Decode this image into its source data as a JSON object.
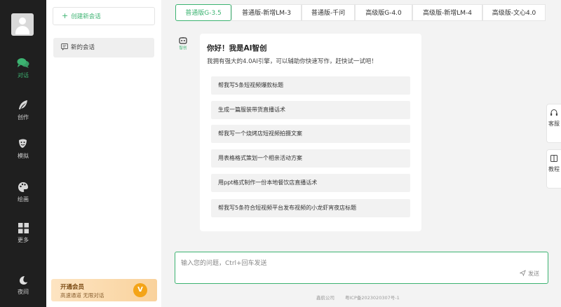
{
  "nav": {
    "items": [
      {
        "label": "对话",
        "icon": "chat-bubbles-icon",
        "active": true
      },
      {
        "label": "创作",
        "icon": "feather-icon",
        "active": false
      },
      {
        "label": "模拟",
        "icon": "masks-icon",
        "active": false
      },
      {
        "label": "绘画",
        "icon": "palette-icon",
        "active": false
      },
      {
        "label": "更多",
        "icon": "grid-icon",
        "active": false
      },
      {
        "label": "夜间",
        "icon": "moon-icon",
        "active": false
      }
    ]
  },
  "panel": {
    "new_chat_label": "创建新会话",
    "conversations": [
      {
        "title": "新的会话"
      }
    ],
    "vip": {
      "title": "开通会员",
      "subtitle": "高速通道 无限对话",
      "badge": "V"
    }
  },
  "models": {
    "tabs": [
      "普通版G-3.5",
      "普通版-新增LM-3",
      "普通版-千问",
      "高级版G-4.0",
      "高级版-新增LM-4",
      "高级版-文心4.0"
    ],
    "active_index": 0
  },
  "bot": {
    "avatar_text": "智创",
    "greeting": "你好！我是AI智创",
    "intro": "我拥有强大的4.0AI引擎，可以辅助你快速写作，赶快试一试吧！",
    "suggestions": [
      "帮我写5条短视频爆款标题",
      "生成一篇服装带货直播话术",
      "帮我写一个烧烤店短视频拍摄文案",
      "用表格格式策划一个相亲活动方案",
      "用ppt格式制作一份本地餐饮店直播话术",
      "帮我写5条符合短视频平台发布视频的小龙虾宵夜店标题"
    ]
  },
  "float_buttons": [
    {
      "label": "客服",
      "icon": "headset-icon"
    },
    {
      "label": "教程",
      "icon": "book-icon"
    }
  ],
  "composer": {
    "placeholder": "输入您的问题，Ctrl+回车发送",
    "send_label": "发送"
  },
  "footer": {
    "company": "鑫航公司",
    "icp": "粤ICP备2023020307号-1"
  },
  "colors": {
    "accent": "#3cb371",
    "nav_bg": "#1f1f1f",
    "vip_badge": "#f4a418"
  }
}
